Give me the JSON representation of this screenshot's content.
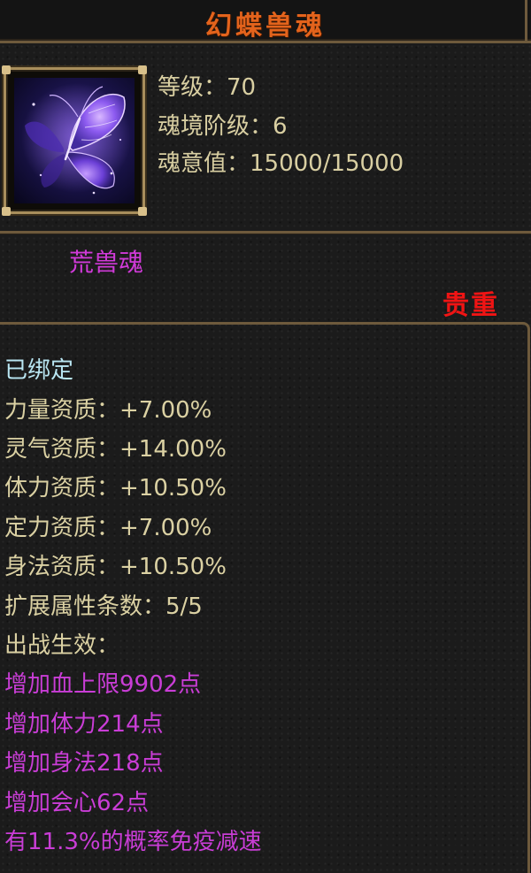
{
  "title": "幻蝶兽魂",
  "icon": {
    "name": "butterfly-soul-icon",
    "colors": [
      "#6b4ee0",
      "#b07cf5",
      "#3a2a8a"
    ]
  },
  "stats": {
    "level": "等级：70",
    "realm_stage": "魂境阶级：6",
    "soul_value": "魂意值：15000/15000"
  },
  "type_label": "荒兽魂",
  "quality": "贵重",
  "details": {
    "bound": "已绑定",
    "attributes": [
      "力量资质：+7.00%",
      "灵气资质：+14.00%",
      "体力资质：+10.50%",
      "定力资质：+7.00%",
      "身法资质：+10.50%",
      "扩展属性条数：5/5",
      "出战生效："
    ],
    "effects": [
      "增加血上限9902点",
      "增加体力214点",
      "增加身法218点",
      "增加会心62点",
      "有11.3%的概率免疫减速"
    ]
  },
  "colors": {
    "title": "#e3631c",
    "stat_text": "#d9cfa2",
    "bound": "#b9e6f2",
    "effect": "#c93dd6",
    "quality": "#f01414",
    "border": "#6e5a3c"
  }
}
